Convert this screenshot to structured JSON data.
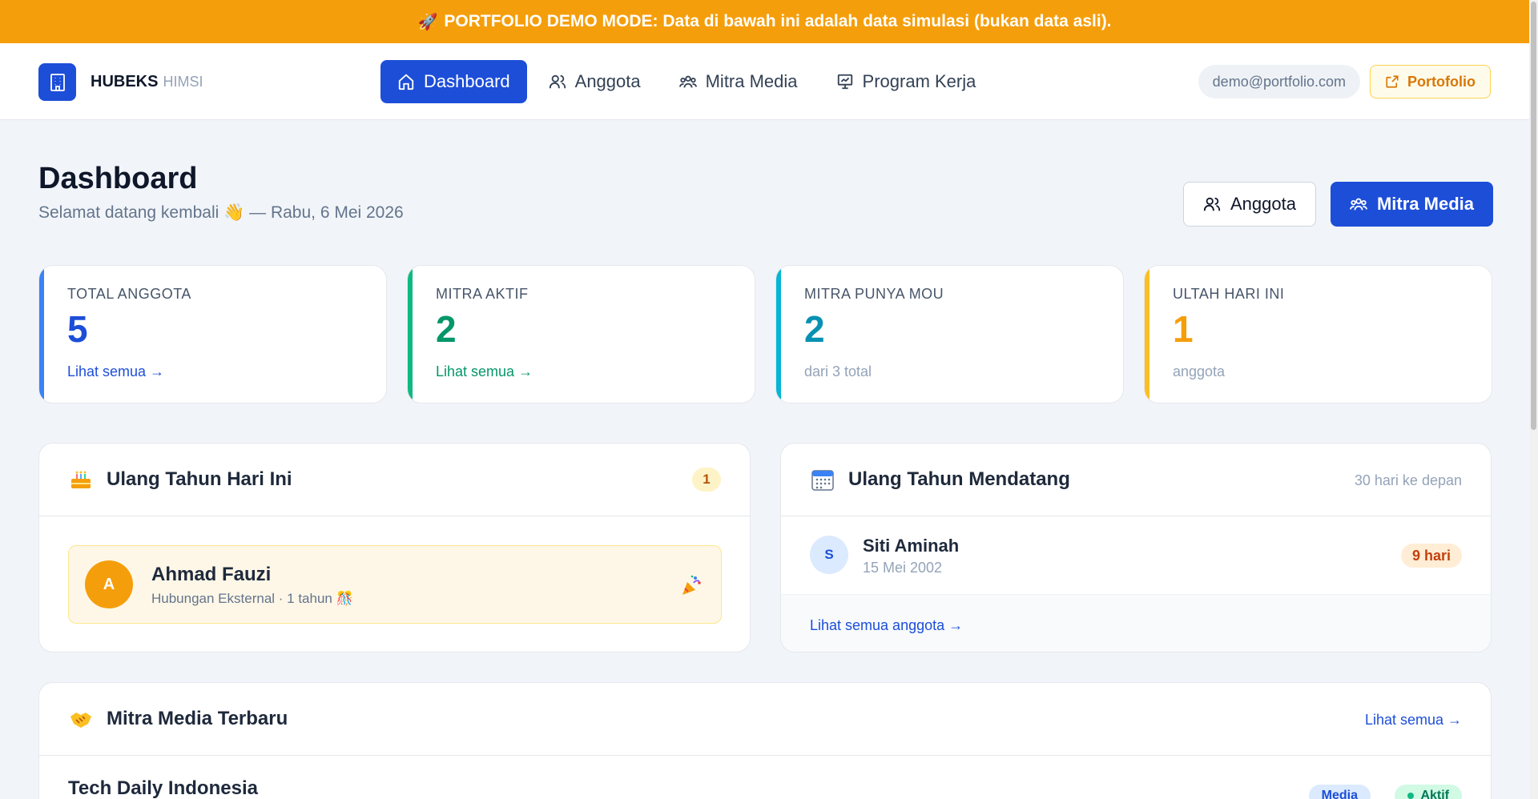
{
  "banner": {
    "icon": "rocket-icon",
    "text": "PORTFOLIO DEMO MODE: Data di bawah ini adalah data simulasi (bukan data asli)."
  },
  "brand": {
    "logo_icon": "building-icon",
    "name": "HUBEKS",
    "sub": "HIMSI"
  },
  "nav": {
    "items": [
      {
        "label": "Dashboard",
        "icon": "home-icon",
        "active": true
      },
      {
        "label": "Anggota",
        "icon": "users-icon",
        "active": false
      },
      {
        "label": "Mitra Media",
        "icon": "group-icon",
        "active": false
      },
      {
        "label": "Program Kerja",
        "icon": "presentation-icon",
        "active": false
      }
    ],
    "email": "demo@portfolio.com",
    "portfolio_label": "Portofolio"
  },
  "header": {
    "title": "Dashboard",
    "subtitle": "Selamat datang kembali 👋 — Rabu, 6 Mei 2026",
    "btn_anggota": "Anggota",
    "btn_mitra": "Mitra Media"
  },
  "stats": [
    {
      "label": "TOTAL ANGGOTA",
      "value": "5",
      "foot": "Lihat semua →",
      "color": "#3b82f6"
    },
    {
      "label": "MITRA AKTIF",
      "value": "2",
      "foot": "Lihat semua →",
      "color": "#10b981"
    },
    {
      "label": "MITRA PUNYA MOU",
      "value": "2",
      "foot": "dari 3 total",
      "color": "#06b6d4"
    },
    {
      "label": "ULTAH HARI INI",
      "value": "1",
      "foot": "anggota",
      "color": "#fbbf24"
    }
  ],
  "birthday_today": {
    "title": "Ulang Tahun Hari Ini",
    "icon": "cake-icon",
    "count": "1",
    "person": {
      "initial": "A",
      "name": "Ahmad Fauzi",
      "meta": "Hubungan Eksternal · 1 tahun 🎊"
    },
    "party_icon": "party-popper-icon"
  },
  "birthday_upcoming": {
    "title": "Ulang Tahun Mendatang",
    "icon": "calendar-icon",
    "hint": "30 hari ke depan",
    "person": {
      "initial": "S",
      "name": "Siti Aminah",
      "date": "15 Mei 2002",
      "days": "9 hari"
    },
    "footer_link": "Lihat semua anggota →"
  },
  "mitra_recent": {
    "title": "Mitra Media Terbaru",
    "icon": "handshake-icon",
    "link": "Lihat semua →",
    "items": [
      {
        "name": "Tech Daily Indonesia",
        "type": "Media",
        "status": "Aktif"
      }
    ]
  },
  "colors": {
    "primary": "#1d4ed8",
    "banner": "#f59e0b",
    "background": "#f1f5f9"
  }
}
